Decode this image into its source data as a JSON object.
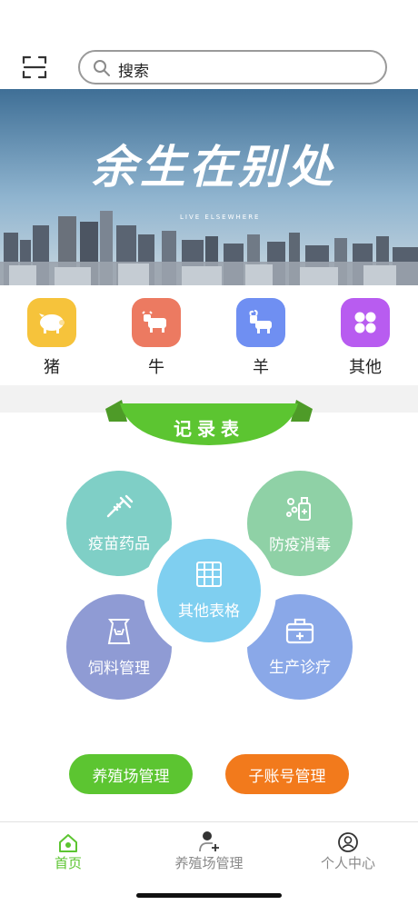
{
  "search": {
    "placeholder": "搜索"
  },
  "banner": {
    "headline": "余生在别处",
    "subline": "LIVE ELSEWHERE"
  },
  "categories": [
    {
      "label": "猪",
      "icon": "pig-icon",
      "color": "#f6c33b"
    },
    {
      "label": "牛",
      "icon": "cow-icon",
      "color": "#ec7a61"
    },
    {
      "label": "羊",
      "icon": "goat-icon",
      "color": "#6f8ff2"
    },
    {
      "label": "其他",
      "icon": "grid-four-icon",
      "color": "#b85cf0"
    }
  ],
  "records": {
    "title": "记录表",
    "items": [
      {
        "label": "疫苗药品",
        "icon": "syringe-icon"
      },
      {
        "label": "防疫消毒",
        "icon": "disinfectant-spray-icon"
      },
      {
        "label": "饲料管理",
        "icon": "feed-bag-icon"
      },
      {
        "label": "生产诊疗",
        "icon": "medical-kit-icon"
      },
      {
        "label": "其他表格",
        "icon": "table-icon"
      }
    ]
  },
  "actions": {
    "farm_manage": "养殖场管理",
    "sub_account": "子账号管理"
  },
  "tabs": [
    {
      "label": "首页",
      "icon": "home-icon",
      "active": true
    },
    {
      "label": "养殖场管理",
      "icon": "farm-add-icon",
      "active": false
    },
    {
      "label": "个人中心",
      "icon": "user-icon",
      "active": false
    }
  ],
  "colors": {
    "accent_green": "#5cc531",
    "accent_orange": "#f27a1c"
  }
}
